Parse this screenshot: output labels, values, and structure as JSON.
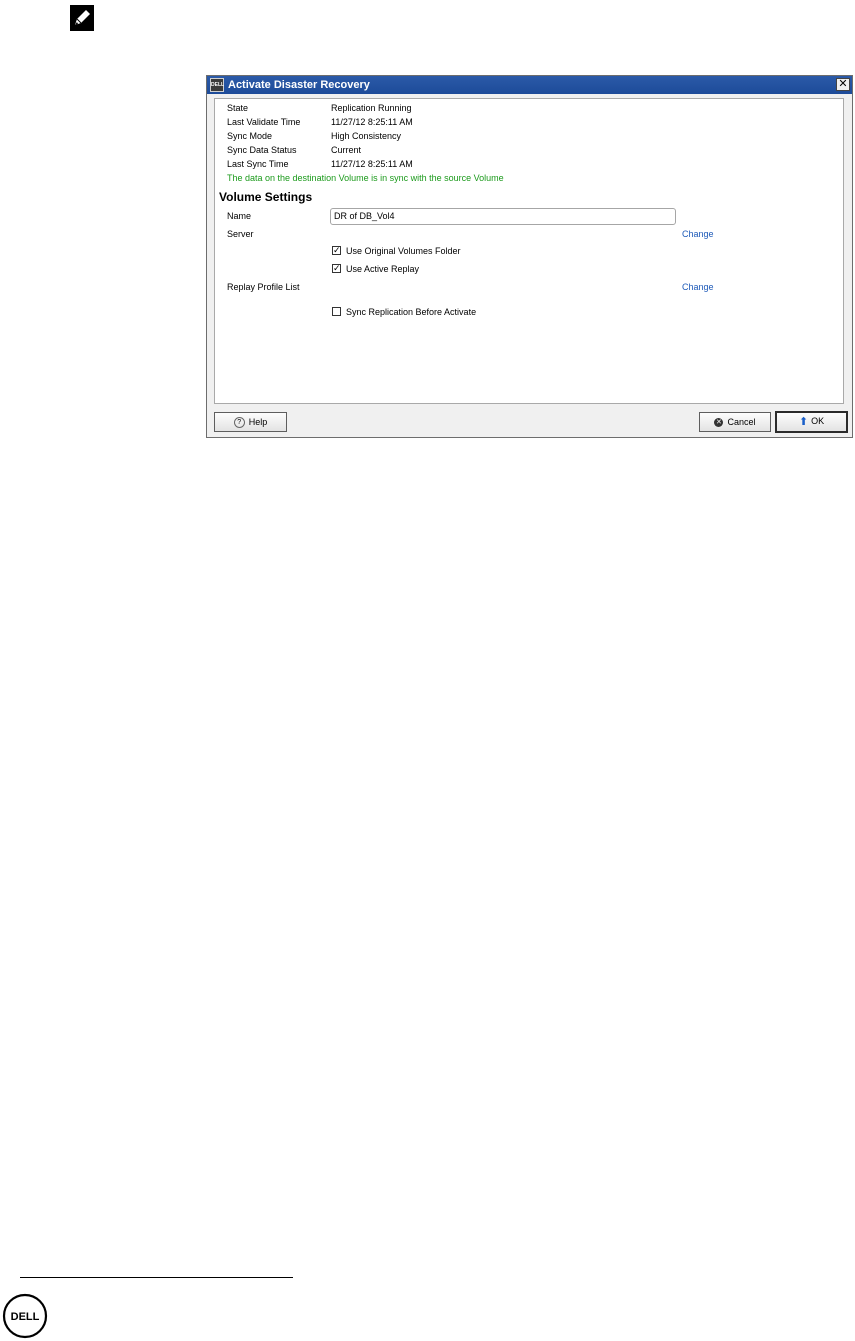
{
  "dialog": {
    "title": "Activate Disaster Recovery",
    "app_icon_text": "DELL",
    "close_glyph": "✕"
  },
  "status": {
    "rows": [
      {
        "label": "State",
        "value": "Replication Running"
      },
      {
        "label": "Last Validate Time",
        "value": "11/27/12 8:25:11 AM"
      },
      {
        "label": "Sync Mode",
        "value": "High Consistency"
      },
      {
        "label": "Sync Data Status",
        "value": "Current"
      },
      {
        "label": "Last Sync Time",
        "value": "11/27/12 8:25:11 AM"
      }
    ],
    "message": "The data on the destination Volume is in sync with the source Volume",
    "message_color": "#1b9a1b"
  },
  "volume_settings": {
    "title": "Volume Settings",
    "name_label": "Name",
    "name_value": "DR of DB_Vol4",
    "server_label": "Server",
    "server_change": "Change",
    "use_original_folder": {
      "label": "Use Original Volumes Folder",
      "checked": true
    },
    "use_active_replay": {
      "label": "Use Active Replay",
      "checked": true
    },
    "replay_profile_label": "Replay Profile List",
    "replay_profile_change": "Change",
    "sync_before_activate": {
      "label": "Sync Replication Before Activate",
      "checked": false
    }
  },
  "buttons": {
    "help": "Help",
    "cancel": "Cancel",
    "ok": "OK"
  },
  "icons": {
    "note": "pencil-note-icon",
    "logo": "dell-logo",
    "help": "question-icon",
    "cancel": "x-circle-icon",
    "ok": "up-arrow-icon"
  },
  "colors": {
    "titlebar": "#1d4b99",
    "link": "#1e5ab8"
  },
  "brand": {
    "logo_text": "DELL"
  }
}
